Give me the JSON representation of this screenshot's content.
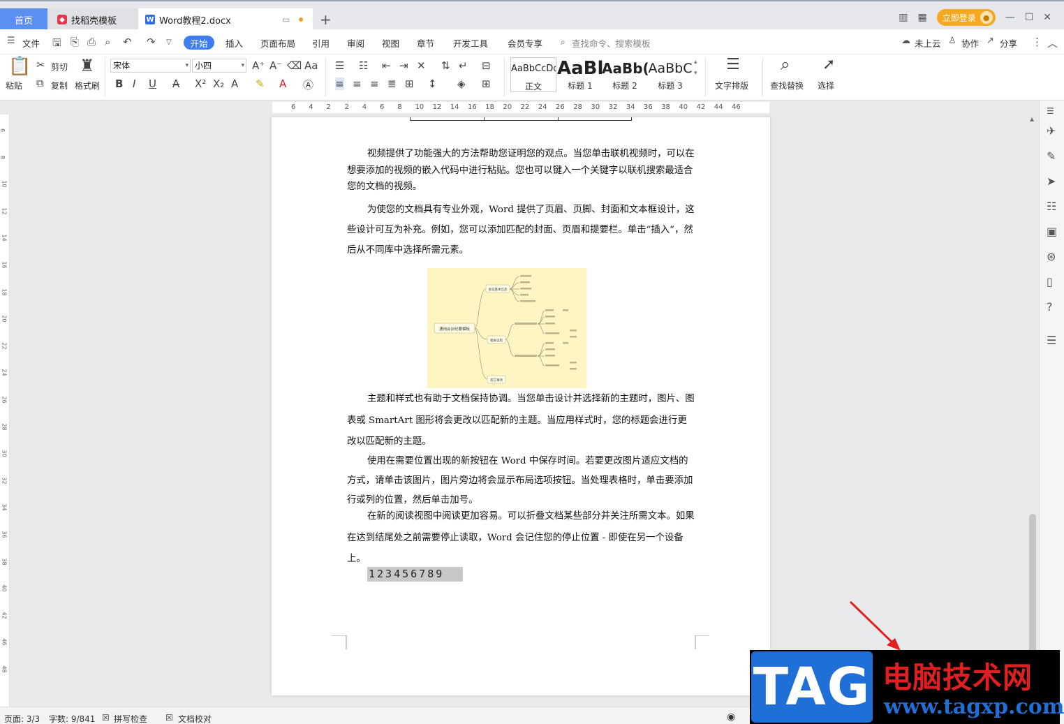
{
  "tabs": {
    "home": "首页",
    "template": "找稻壳模板",
    "doc": "Word教程2.docx",
    "new": "+",
    "login": "立即登录"
  },
  "menu": {
    "file": "文件",
    "start": "开始",
    "insert": "插入",
    "layout": "页面布局",
    "reference": "引用",
    "review": "审阅",
    "view": "视图",
    "chapter": "章节",
    "dev": "开发工具",
    "member": "会员专享",
    "search": "查找命令、搜索模板",
    "cloud": "未上云",
    "collab": "协作",
    "share": "分享"
  },
  "ribbon": {
    "paste": "粘贴",
    "cut": "剪切",
    "copy": "复制",
    "format_painter": "格式刷",
    "font_name": "宋体",
    "font_size": "小四",
    "styles": [
      {
        "preview": "AaBbCcDd",
        "name": "正文"
      },
      {
        "preview": "AaBl",
        "name": "标题 1"
      },
      {
        "preview": "AaBb(",
        "name": "标题 2"
      },
      {
        "preview": "AaBbC",
        "name": "标题 3"
      }
    ],
    "text_layout": "文字排版",
    "find_replace": "查找替换",
    "select": "选择"
  },
  "ruler": {
    "top_numbers": [
      "6",
      "4",
      "2",
      "2",
      "4",
      "6",
      "8",
      "10",
      "12",
      "14",
      "16",
      "18",
      "20",
      "22",
      "24",
      "26",
      "28",
      "30",
      "32",
      "34",
      "36",
      "38",
      "40",
      "42",
      "44",
      "46"
    ],
    "left_numbers": [
      "6",
      "8",
      "10",
      "12",
      "14",
      "16",
      "18",
      "20",
      "22",
      "24",
      "26",
      "28",
      "30",
      "32",
      "34",
      "36",
      "38",
      "40",
      "42",
      "46",
      "48"
    ]
  },
  "document": {
    "paragraphs": [
      "视频提供了功能强大的方法帮助您证明您的观点。当您单击联机视频时，可以在想要添加的视频的嵌入代码中进行粘贴。您也可以键入一个关键字以联机搜索最适合您的文档的视频。",
      "为使您的文档具有专业外观，Word 提供了页眉、页脚、封面和文本框设计，这些设计可互为补充。例如，您可以添加匹配的封面、页眉和提要栏。单击“插入”，然后从不同库中选择所需元素。",
      "主题和样式也有助于文档保持协调。当您单击设计并选择新的主题时，图片、图表或 SmartArt 图形将会更改以匹配新的主题。当应用样式时，您的标题会进行更改以匹配新的主题。",
      "使用在需要位置出现的新按钮在 Word 中保存时间。若要更改图片适应文档的方式，请单击该图片，图片旁边将会显示布局选项按钮。当处理表格时，单击要添加行或列的位置，然后单击加号。",
      "在新的阅读视图中阅读更加容易。可以折叠文档某些部分并关注所需文本。如果在达到结尾处之前需要停止读取，Word 会记住您的停止位置 - 即使在另一个设备上。"
    ],
    "number_line": "123456789",
    "mindmap": {
      "root": "通用会议纪要模板",
      "branches": [
        "会议基本信息",
        "相关议程",
        "其它事项"
      ]
    }
  },
  "status": {
    "page": "页面: 3/3",
    "words": "字数: 9/841",
    "spell": "拼写检查",
    "proof": "文档校对"
  },
  "watermark": {
    "tag": "TAG",
    "site_name": "电脑技术网",
    "url": "www.tagxp.com"
  },
  "colors": {
    "accent": "#3e7cf2",
    "tab_home": "#5b8ff0",
    "login": "#f6a821",
    "mindmap_bg": "#fdf6c3",
    "arrow": "#e02020"
  }
}
